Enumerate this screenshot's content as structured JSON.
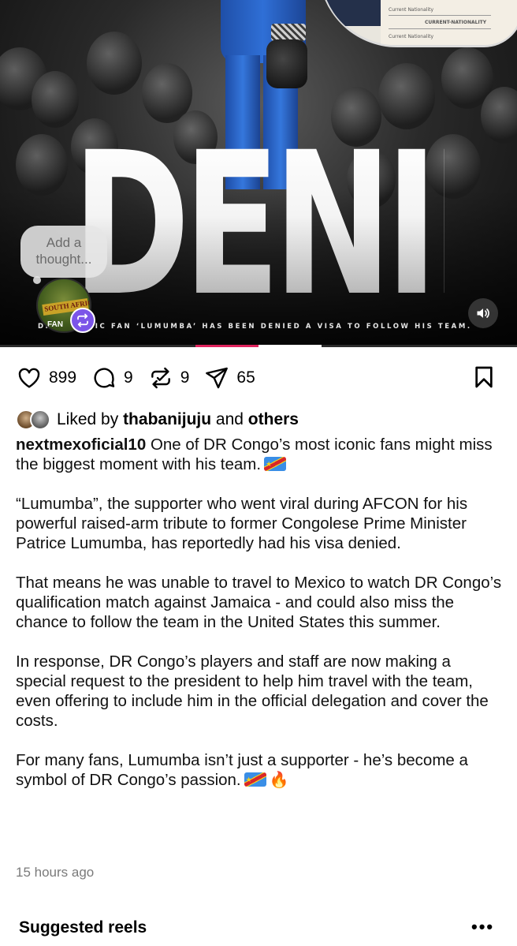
{
  "media": {
    "headline": "DENIED",
    "caption": "DR CONGO'S ICONIC FAN 'LUMUMBA' HAS BEEN DENIED A VISA TO FOLLOW HIS TEAM.",
    "caption_visible": "DR    S ICONIC FAN ‘LUMUMBA’ HAS BEEN DENIED A VISA TO FOLLOW HIS TEAM.",
    "thought_placeholder": "Add a thought...",
    "story_banner": "SOUTH AFRICA",
    "story_fan": "FAN",
    "document_labels": [
      "Current Nationality",
      "CURRENT-NATIONALITY",
      "Current Nationality"
    ],
    "sound_icon": "speaker-icon",
    "progress_color": "#e0245e",
    "repost_badge_color": "#7b55e8"
  },
  "actions": {
    "likes": "899",
    "comments": "9",
    "reposts": "9",
    "shares": "65"
  },
  "liked_by": {
    "prefix": "Liked by",
    "user": "thabanijuju",
    "and": "and",
    "others": "others"
  },
  "post": {
    "username": "nextmexoficial10",
    "intro": "One of DR Congo’s most iconic fans might miss the biggest moment with his team.",
    "p1": "“Lumumba”, the supporter who went viral during AFCON for his powerful raised-arm tribute to former Congolese Prime Minister Patrice Lumumba, has reportedly had his visa denied.",
    "p2": "That means he was unable to travel to Mexico to watch DR Congo’s qualification match against Jamaica - and could also miss the chance to follow the team in the United States this summer.",
    "p3": "In response, DR Congo’s players and staff are now making a special request to the president to help him travel with the team, even offering to include him in the official delegation and cover the costs.",
    "p4": "For many fans, Lumumba isn’t just a supporter - he’s become a symbol of DR Congo’s passion.",
    "timestamp": "15 hours ago"
  },
  "suggested": {
    "title": "Suggested reels",
    "more": "•••"
  }
}
